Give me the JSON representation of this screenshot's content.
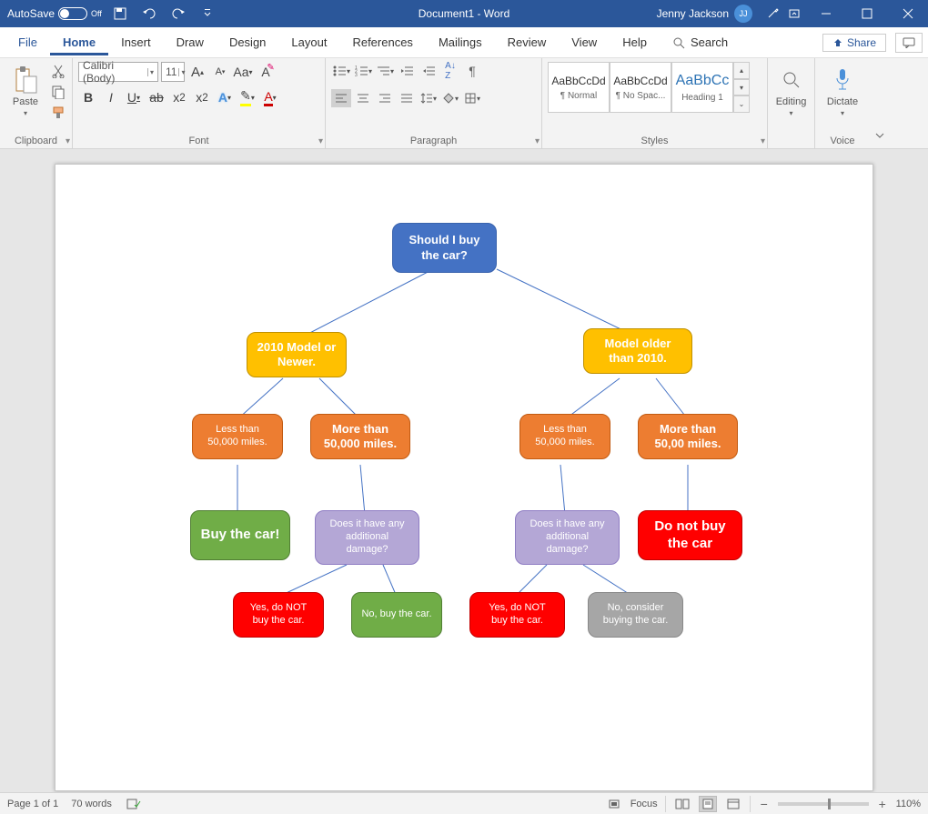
{
  "titlebar": {
    "autosave_label": "AutoSave",
    "autosave_state": "Off",
    "doc_title": "Document1 - Word",
    "user_name": "Jenny Jackson",
    "user_initials": "JJ"
  },
  "tabs": {
    "file": "File",
    "home": "Home",
    "insert": "Insert",
    "draw": "Draw",
    "design": "Design",
    "layout": "Layout",
    "references": "References",
    "mailings": "Mailings",
    "review": "Review",
    "view": "View",
    "help": "Help",
    "search": "Search",
    "share": "Share"
  },
  "ribbon": {
    "clipboard": {
      "label": "Clipboard",
      "paste": "Paste"
    },
    "font": {
      "label": "Font",
      "font_name": "Calibri (Body)",
      "font_size": "11"
    },
    "paragraph": {
      "label": "Paragraph"
    },
    "styles": {
      "label": "Styles",
      "items": [
        {
          "preview": "AaBbCcDd",
          "label": "¶ Normal"
        },
        {
          "preview": "AaBbCcDd",
          "label": "¶ No Spac..."
        },
        {
          "preview": "AaBbCc",
          "label": "Heading 1"
        }
      ]
    },
    "editing": {
      "label": "Editing"
    },
    "voice": {
      "label": "Voice",
      "dictate": "Dictate"
    }
  },
  "chart_data": {
    "type": "tree",
    "nodes": {
      "root": {
        "text": "Should I buy the car?",
        "color": "blue"
      },
      "l1": {
        "text": "2010 Model or Newer.",
        "color": "amber"
      },
      "r1": {
        "text": "Model older than 2010.",
        "color": "amber"
      },
      "l1a": {
        "text": "Less than 50,000 miles.",
        "color": "orange"
      },
      "l1b": {
        "text": "More than 50,000 miles.",
        "color": "orange"
      },
      "r1a": {
        "text": "Less than 50,000 miles.",
        "color": "orange"
      },
      "r1b": {
        "text": "More than 50,00 miles.",
        "color": "orange"
      },
      "l1a1": {
        "text": "Buy the car!",
        "color": "green"
      },
      "l1b1": {
        "text": "Does it have any additional damage?",
        "color": "lavender"
      },
      "r1a1": {
        "text": "Does it have any additional damage?",
        "color": "lavender"
      },
      "r1b1": {
        "text": "Do not buy the car",
        "color": "red"
      },
      "l1b1y": {
        "text": "Yes, do NOT buy the car.",
        "color": "red"
      },
      "l1b1n": {
        "text": "No, buy the car.",
        "color": "green"
      },
      "r1a1y": {
        "text": "Yes, do NOT buy the car.",
        "color": "red"
      },
      "r1a1n": {
        "text": "No, consider buying the car.",
        "color": "gray"
      }
    },
    "edges": [
      [
        "root",
        "l1"
      ],
      [
        "root",
        "r1"
      ],
      [
        "l1",
        "l1a"
      ],
      [
        "l1",
        "l1b"
      ],
      [
        "r1",
        "r1a"
      ],
      [
        "r1",
        "r1b"
      ],
      [
        "l1a",
        "l1a1"
      ],
      [
        "l1b",
        "l1b1"
      ],
      [
        "r1a",
        "r1a1"
      ],
      [
        "r1b",
        "r1b1"
      ],
      [
        "l1b1",
        "l1b1y"
      ],
      [
        "l1b1",
        "l1b1n"
      ],
      [
        "r1a1",
        "r1a1y"
      ],
      [
        "r1a1",
        "r1a1n"
      ]
    ]
  },
  "statusbar": {
    "page": "Page 1 of 1",
    "words": "70 words",
    "focus": "Focus",
    "zoom": "110%",
    "zoom_pct": 55
  }
}
